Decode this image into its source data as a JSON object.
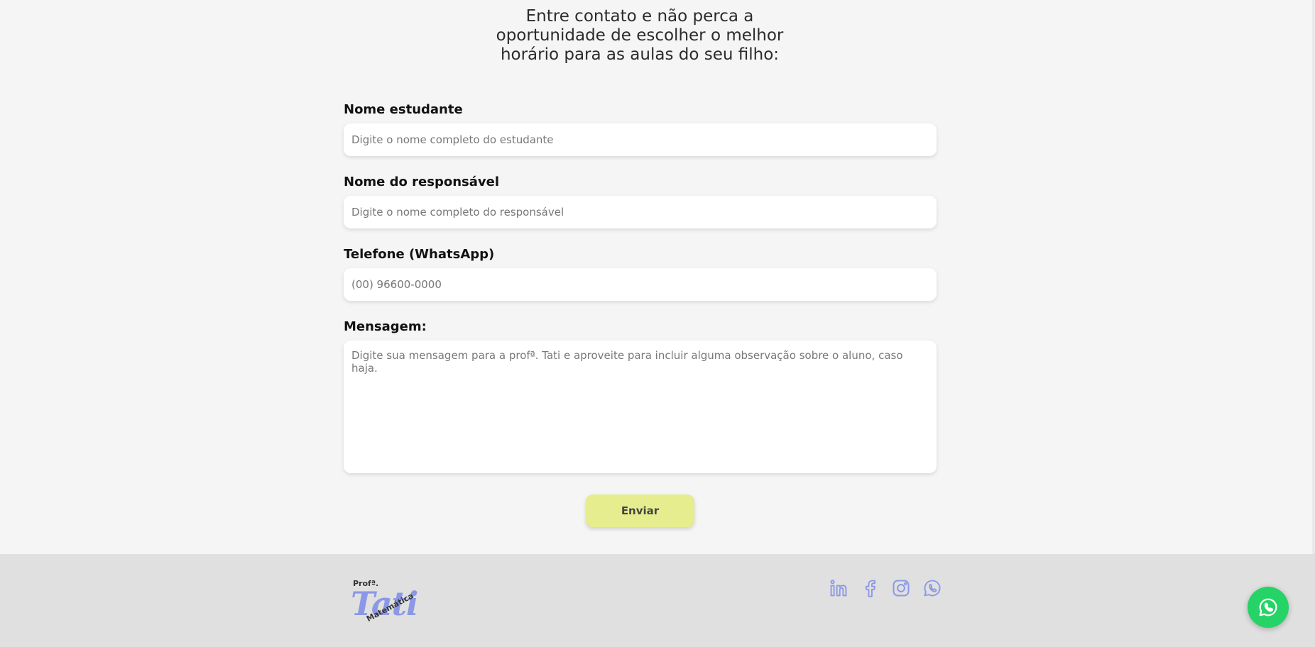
{
  "intro": {
    "line1": "Entre contato e não perca a",
    "line2": "oportunidade de escolher o melhor",
    "line3": "horário para as aulas do seu filho:"
  },
  "form": {
    "student_label": "Nome estudante",
    "student_placeholder": "Digite o nome completo do estudante",
    "guardian_label": "Nome do responsável",
    "guardian_placeholder": "Digite o nome completo do responsável",
    "phone_label": "Telefone (WhatsApp)",
    "phone_placeholder": "(00) 96600-0000",
    "message_label": "Mensagem:",
    "message_placeholder": "Digite sua mensagem para a profª. Tati e aproveite para incluir alguma observação sobre o aluno, caso haja.",
    "submit_label": "Enviar"
  },
  "footer": {
    "logo": {
      "prof": "Profª.",
      "name": "Tati",
      "subject": "Matemática"
    },
    "socials": [
      "linkedin-icon",
      "facebook-icon",
      "instagram-icon",
      "whatsapp-icon"
    ]
  },
  "colors": {
    "background": "#f5f5f5",
    "footer": "#e0e0e0",
    "accent_button": "#e5ed8e",
    "brand_blue": "#8b98e6",
    "whatsapp_green": "#25d366"
  }
}
